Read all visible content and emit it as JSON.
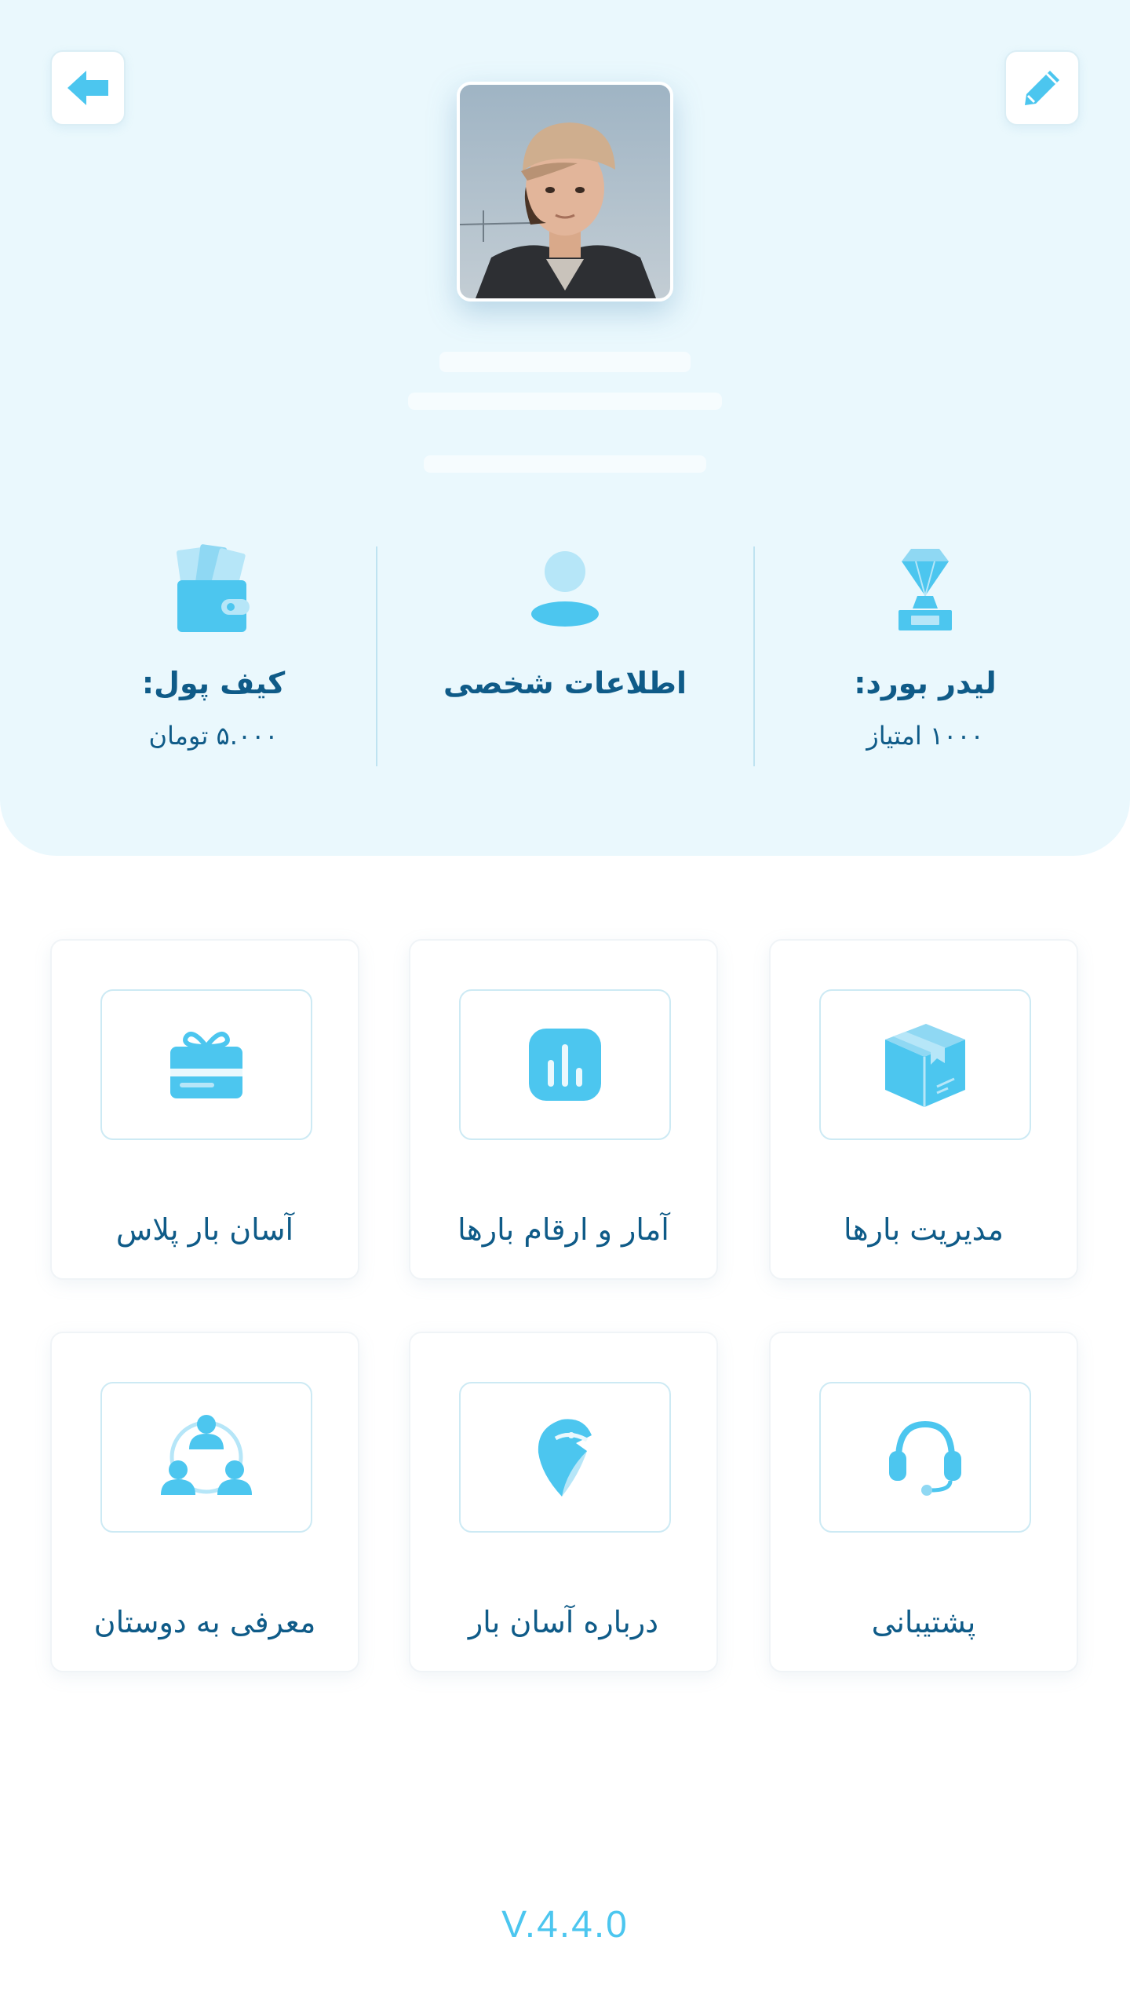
{
  "header": {
    "back_icon": "arrow-left-icon",
    "edit_icon": "pencil-icon",
    "avatar": "profile-photo"
  },
  "stats": {
    "wallet": {
      "title": "کیف پول:",
      "value": "۵.۰۰۰ تومان",
      "icon": "wallet-icon"
    },
    "personal_info": {
      "title": "اطلاعات شخصی",
      "icon": "user-icon"
    },
    "leaderboard": {
      "title": "لیدر بورد:",
      "value": "۱۰۰۰ امتیاز",
      "icon": "trophy-icon"
    }
  },
  "tiles": [
    {
      "label": "مدیریت بارها",
      "icon": "package-box-icon"
    },
    {
      "label": "آمار و ارقام بارها",
      "icon": "bar-chart-icon"
    },
    {
      "label": "آسان بار پلاس",
      "icon": "gift-card-icon"
    },
    {
      "label": "پشتیبانی",
      "icon": "headset-icon"
    },
    {
      "label": "درباره آسان بار",
      "icon": "eagle-pin-icon"
    },
    {
      "label": "معرفی به دوستان",
      "icon": "referral-users-icon"
    }
  ],
  "version": "V.4.4.0",
  "colors": {
    "accent": "#4cc6ef",
    "header_bg": "#eaf8fd",
    "text": "#0f5b88"
  }
}
